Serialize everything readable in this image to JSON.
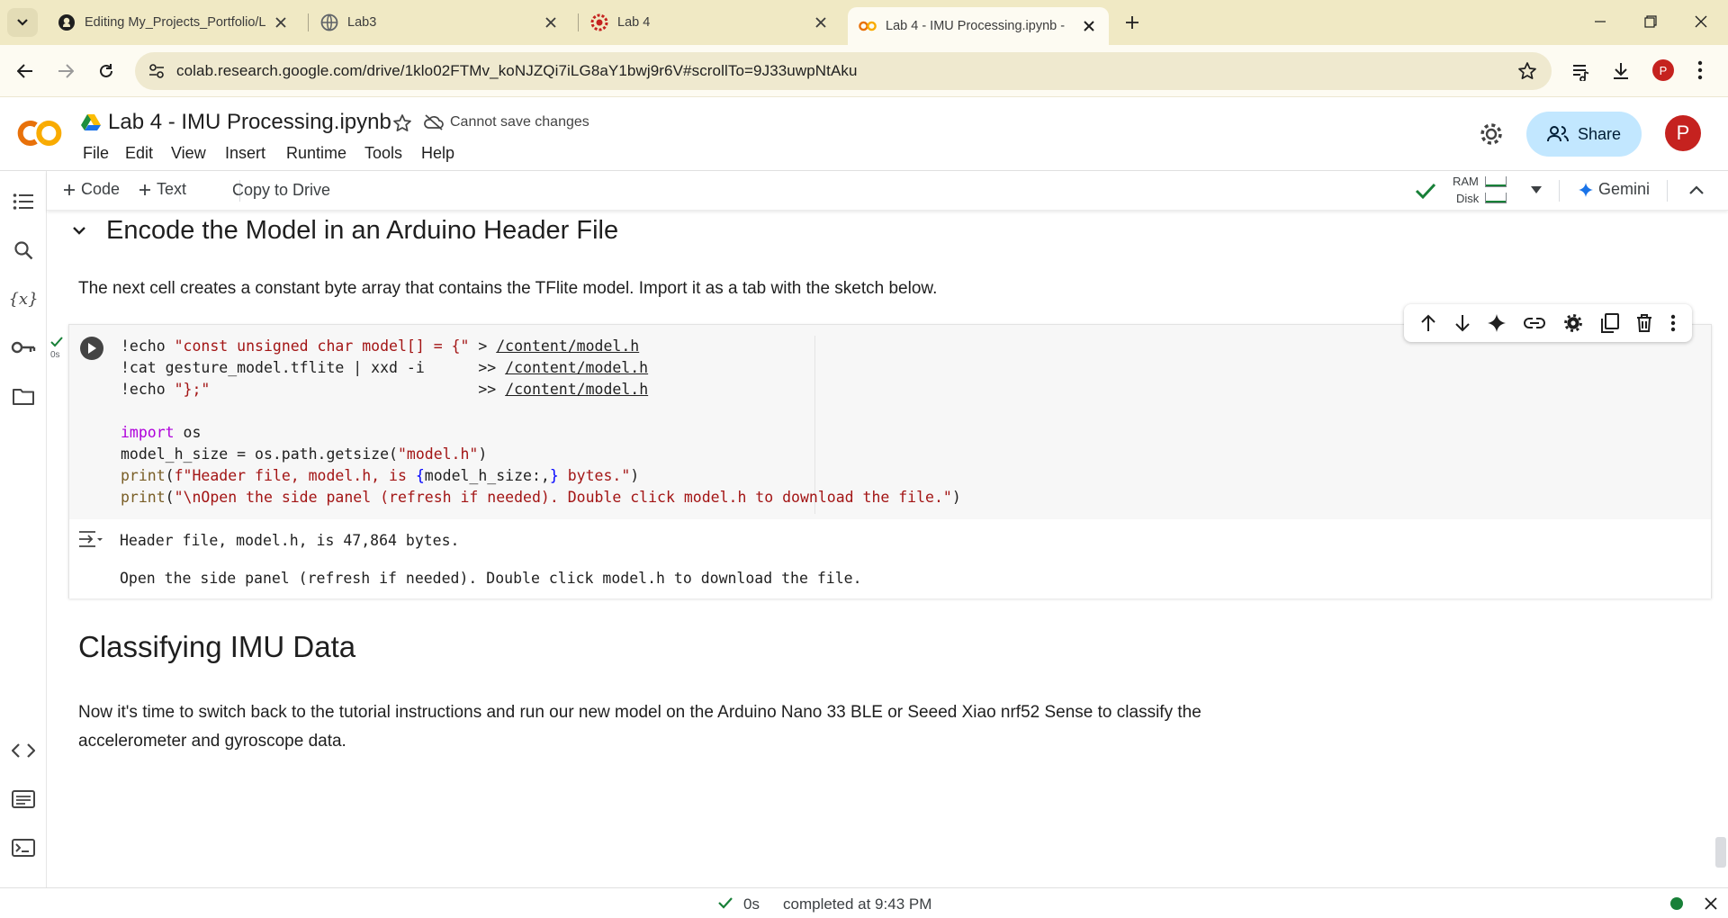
{
  "browser": {
    "tabs": [
      {
        "title": "Editing My_Projects_Portfolio/L",
        "icon": "github-icon"
      },
      {
        "title": "Lab3",
        "icon": "globe-icon"
      },
      {
        "title": "Lab 4",
        "icon": "gear-favicon-icon"
      },
      {
        "title": "Lab 4 - IMU Processing.ipynb -",
        "icon": "colab-favicon-icon"
      }
    ],
    "url": "colab.research.google.com/drive/1klo02FTMv_koNJZQi7iLG8aY1bwj9r6V#scrollTo=9J33uwpNtAku",
    "profile_initial": "P"
  },
  "colab": {
    "logo": "CO",
    "notebook_title": "Lab 4 - IMU Processing.ipynb",
    "save_status": "Cannot save changes",
    "menu": [
      "File",
      "Edit",
      "View",
      "Insert",
      "Runtime",
      "Tools",
      "Help"
    ],
    "share_label": "Share",
    "avatar_initial": "P",
    "toolbar": {
      "code_label": "Code",
      "text_label": "Text",
      "copy_label": "Copy to Drive",
      "ram_label": "RAM",
      "disk_label": "Disk",
      "gemini_label": "Gemini"
    }
  },
  "notebook": {
    "section_heading": "Encode the Model in an Arduino Header File",
    "section_text": "The next cell creates a constant byte array that contains the TFlite model. Import it as a tab with the sketch below.",
    "cell_exec_time": "0s",
    "output_line1": "Header file, model.h, is 47,864 bytes.",
    "output_line2": "Open the side panel (refresh if needed). Double click model.h to download the file.",
    "heading2": "Classifying IMU Data",
    "para2": "Now it's time to switch back to the tutorial instructions and run our new model on the Arduino Nano 33 BLE or Seeed Xiao nrf52 Sense to classify the accelerometer and gyroscope data."
  },
  "status": {
    "elapsed": "0s",
    "completed": "completed at 9:43 PM"
  },
  "colors": {
    "tabstrip": "#f0e9c4",
    "share_bg": "#c2e7ff",
    "colab_orange": "#f9ab00",
    "string_red": "#a31515",
    "keyword_purple": "#af00db",
    "success_green": "#188038"
  }
}
